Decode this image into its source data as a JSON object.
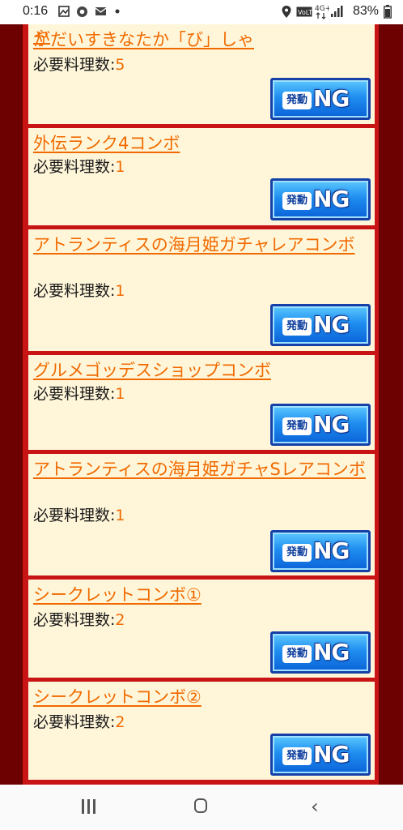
{
  "status_bar": {
    "time": "0:16",
    "battery": "83%",
    "icons": [
      "image-icon",
      "chrome-icon",
      "mail-icon",
      "dot-icon",
      "location-icon",
      "volte-icon",
      "4g-icon",
      "signal-icon",
      "battery-icon"
    ]
  },
  "colors": {
    "title": "#f06a00",
    "card_bg": "#fff6d9",
    "frame_red": "#c81414",
    "outer_maroon": "#6d0000",
    "button_blue": "#1f8ef0"
  },
  "combos": [
    {
      "title": "がだいすきなたか「び」しゃ",
      "req_label": "必要料理数:",
      "req_value": "5",
      "button_badge": "発動",
      "button_label": "NG"
    },
    {
      "title": "外伝ランク4コンボ",
      "req_label": "必要料理数:",
      "req_value": "1",
      "button_badge": "発動",
      "button_label": "NG"
    },
    {
      "title": "アトランティスの海月姫ガチャレアコンボ",
      "req_label": "必要料理数:",
      "req_value": "1",
      "button_badge": "発動",
      "button_label": "NG"
    },
    {
      "title": "グルメゴッデスショップコンボ",
      "req_label": "必要料理数:",
      "req_value": "1",
      "button_badge": "発動",
      "button_label": "NG"
    },
    {
      "title": "アトランティスの海月姫ガチャSレアコンボ",
      "req_label": "必要料理数:",
      "req_value": "1",
      "button_badge": "発動",
      "button_label": "NG"
    },
    {
      "title": "シークレットコンボ①",
      "req_label": "必要料理数:",
      "req_value": "2",
      "button_badge": "発動",
      "button_label": "NG"
    },
    {
      "title": "シークレットコンボ②",
      "req_label": "必要料理数:",
      "req_value": "2",
      "button_badge": "発動",
      "button_label": "NG"
    }
  ],
  "nav_bar": {
    "icons": [
      "recent-apps-icon",
      "home-icon",
      "back-icon"
    ]
  }
}
